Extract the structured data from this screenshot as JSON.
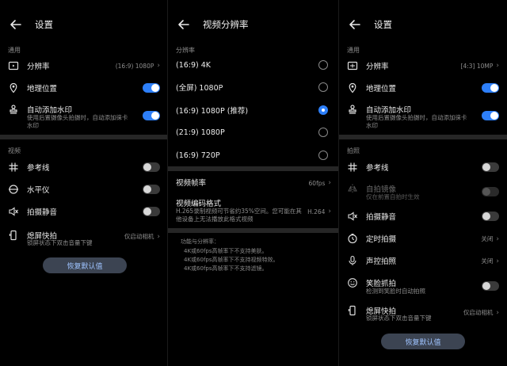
{
  "p1": {
    "title": "设置",
    "sec_general": "通用",
    "resolution": {
      "label": "分辨率",
      "value": "(16:9) 1080P"
    },
    "location": {
      "label": "地理位置",
      "on": true
    },
    "watermark": {
      "label": "自动添加水印",
      "sub1": "使用后置摄像头拍摄时，自动添加徕卡",
      "sub2": "水印",
      "on": true
    },
    "sec_video": "视频",
    "gridline": {
      "label": "参考线",
      "on": false
    },
    "level": {
      "label": "水平仪",
      "on": false
    },
    "mute": {
      "label": "拍摄静音",
      "on": false
    },
    "quicksnap": {
      "label": "熄屏快拍",
      "sub": "锁屏状态下双击音量下键",
      "value": "仅启动相机"
    },
    "reset": "恢复默认值"
  },
  "p2": {
    "title": "视频分辨率",
    "sec": "分辨率",
    "options": [
      {
        "label": "(16:9) 4K",
        "selected": false
      },
      {
        "label": "(全屏) 1080P",
        "selected": false
      },
      {
        "label": "(16:9) 1080P (推荐)",
        "selected": true
      },
      {
        "label": "(21:9) 1080P",
        "selected": false
      },
      {
        "label": "(16:9) 720P",
        "selected": false
      }
    ],
    "framerate": {
      "label": "视频帧率",
      "value": "60fps"
    },
    "codec": {
      "label": "视频编码格式",
      "sub1": "H.265录制视频可节省约35%空间。您可能在其",
      "sub2": "他设备上无法播放此格式视频",
      "value": "H.264"
    },
    "notes": [
      "功能与分辨率：",
      "4K或60fps高帧率下不支持美肤。",
      "4K或60fps高帧率下不支持视频特效。",
      "4K或60fps高帧率下不支持滤镜。"
    ]
  },
  "p3": {
    "title": "设置",
    "sec_general": "通用",
    "resolution": {
      "label": "分辨率",
      "value": "[4:3] 10MP"
    },
    "location": {
      "label": "地理位置",
      "on": true
    },
    "watermark": {
      "label": "自动添加水印",
      "sub1": "使用后置摄像头拍摄时，自动添加徕卡",
      "sub2": "水印",
      "on": true
    },
    "sec_photo": "拍照",
    "gridline": {
      "label": "参考线",
      "on": false
    },
    "mirror": {
      "label": "自拍镜像",
      "sub": "仅在前置自拍时生效",
      "on": false
    },
    "mute": {
      "label": "拍摄静音",
      "on": false
    },
    "timer": {
      "label": "定时拍摄",
      "value": "关闭"
    },
    "voice": {
      "label": "声控拍照",
      "value": "关闭"
    },
    "smile": {
      "label": "笑脸抓拍",
      "sub": "检测到笑脸时自动拍照",
      "on": false
    },
    "quicksnap": {
      "label": "熄屏快拍",
      "sub": "锁屏状态下双击音量下键",
      "value": "仅启动相机"
    },
    "reset": "恢复默认值"
  },
  "colors": {
    "accent": "#2d7ff9",
    "bg": "#000000",
    "divider": "#262626"
  }
}
